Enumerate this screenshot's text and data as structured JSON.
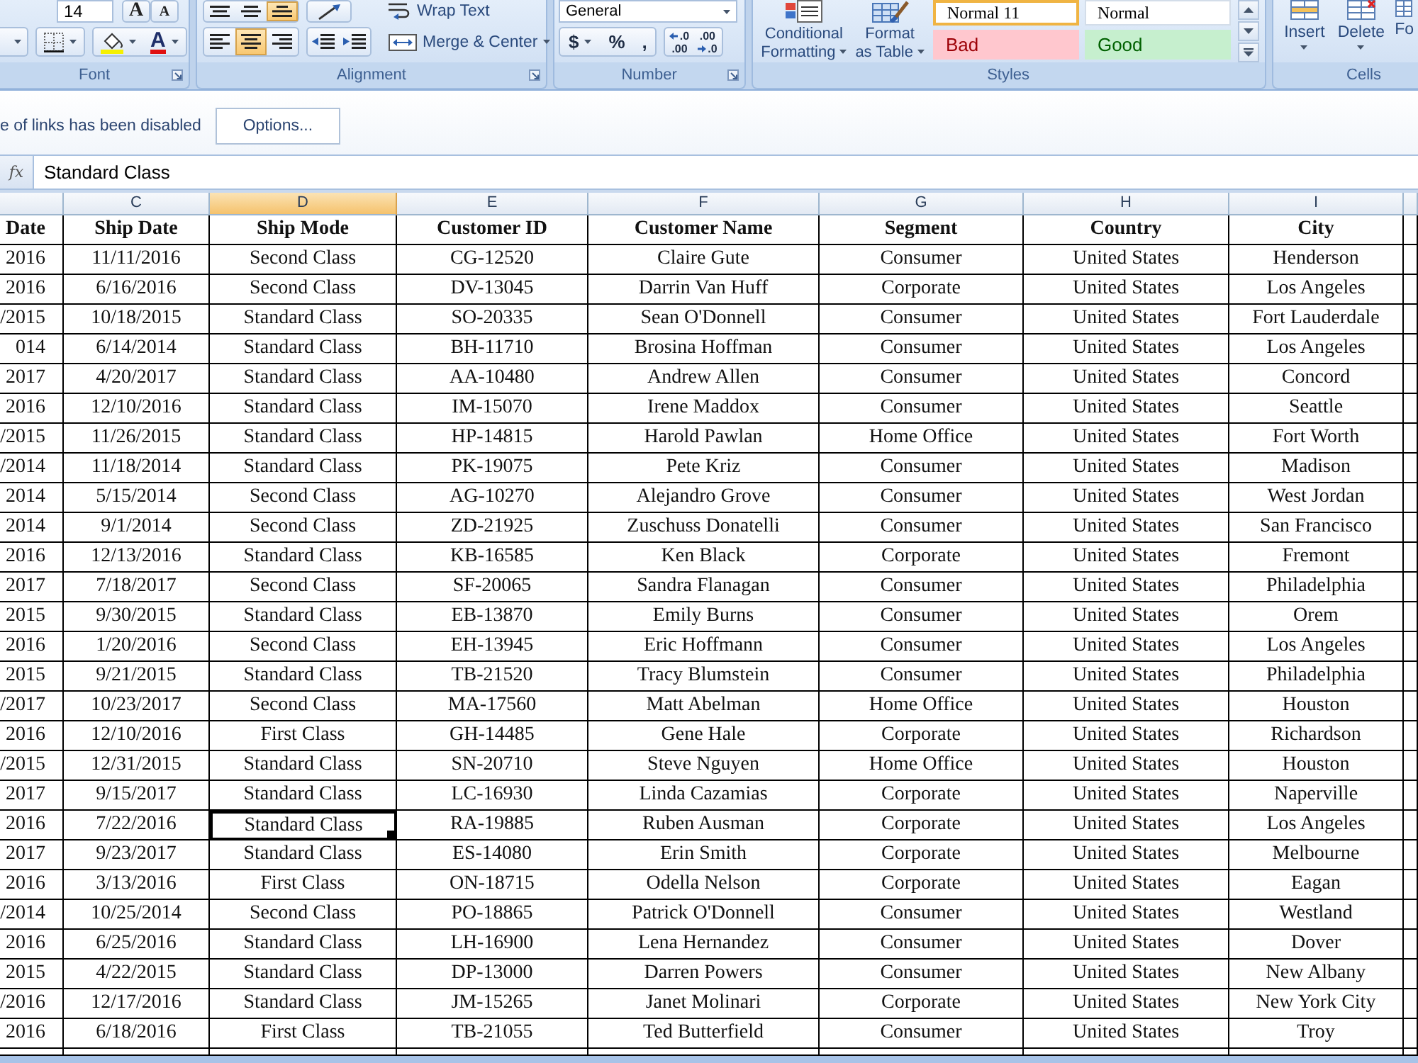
{
  "ribbon": {
    "font_group": {
      "label": "Font",
      "size": "14",
      "grow": "A",
      "shrink": "A",
      "font_color": "A"
    },
    "alignment_group": {
      "label": "Alignment",
      "vertical": [
        {
          "kind": "top",
          "selected": false
        },
        {
          "kind": "middle",
          "selected": false
        },
        {
          "kind": "bottom",
          "selected": true
        }
      ],
      "horizontal": [
        {
          "kind": "left",
          "selected": false
        },
        {
          "kind": "center",
          "selected": true
        },
        {
          "kind": "right",
          "selected": false
        }
      ],
      "wrap": "Wrap Text",
      "merge": "Merge & Center"
    },
    "number_group": {
      "label": "Number",
      "format": "General",
      "currency": "$",
      "percent": "%",
      "comma": ",",
      "decimals": [
        {
          "kind": "increase",
          "top": ".0",
          "bottom": ".00"
        },
        {
          "kind": "decrease",
          "top": ".00",
          "bottom": ".0"
        }
      ]
    },
    "styles_group": {
      "label": "Styles",
      "commands": [
        {
          "kind": "conditional",
          "lines": [
            "Conditional",
            "Formatting"
          ]
        },
        {
          "kind": "table",
          "lines": [
            "Format",
            "as Table"
          ]
        }
      ],
      "gallery": [
        {
          "label": "Normal 11",
          "kind": "normal",
          "selected": true
        },
        {
          "label": "Normal",
          "kind": "normal",
          "selected": false
        },
        {
          "label": "Bad",
          "kind": "bad",
          "selected": false
        },
        {
          "label": "Good",
          "kind": "good",
          "selected": false
        }
      ]
    },
    "cells_group": {
      "label": "Cells",
      "commands": [
        {
          "kind": "insert",
          "label": "Insert",
          "menu": true
        },
        {
          "kind": "delete",
          "label": "Delete",
          "menu": true
        },
        {
          "kind": "format",
          "label": "Fo",
          "menu": false
        }
      ]
    }
  },
  "message_bar": {
    "text": "e of links has been disabled",
    "button": "Options..."
  },
  "formula_bar": {
    "function_label": "fx",
    "value": "Standard Class"
  },
  "table": {
    "columns": [
      {
        "header": "Date",
        "selected": false
      },
      {
        "letter": "C",
        "header": "Ship Date",
        "selected": false
      },
      {
        "letter": "D",
        "header": "Ship Mode",
        "selected": true
      },
      {
        "letter": "E",
        "header": "Customer ID",
        "selected": false
      },
      {
        "letter": "F",
        "header": "Customer Name",
        "selected": false
      },
      {
        "letter": "G",
        "header": "Segment",
        "selected": false
      },
      {
        "letter": "H",
        "header": "Country",
        "selected": false
      },
      {
        "letter": "I",
        "header": "City",
        "selected": false
      }
    ],
    "rows": [
      {
        "cells": [
          "2016",
          "11/11/2016",
          "Second Class",
          "CG-12520",
          "Claire Gute",
          "Consumer",
          "United States",
          "Henderson"
        ],
        "selected": false
      },
      {
        "cells": [
          "2016",
          "6/16/2016",
          "Second Class",
          "DV-13045",
          "Darrin Van Huff",
          "Corporate",
          "United States",
          "Los Angeles"
        ],
        "selected": false
      },
      {
        "cells": [
          "/2015",
          "10/18/2015",
          "Standard Class",
          "SO-20335",
          "Sean O'Donnell",
          "Consumer",
          "United States",
          "Fort Lauderdale"
        ],
        "selected": false
      },
      {
        "cells": [
          "014",
          "6/14/2014",
          "Standard Class",
          "BH-11710",
          "Brosina Hoffman",
          "Consumer",
          "United States",
          "Los Angeles"
        ],
        "selected": false
      },
      {
        "cells": [
          "2017",
          "4/20/2017",
          "Standard Class",
          "AA-10480",
          "Andrew Allen",
          "Consumer",
          "United States",
          "Concord"
        ],
        "selected": false
      },
      {
        "cells": [
          "2016",
          "12/10/2016",
          "Standard Class",
          "IM-15070",
          "Irene Maddox",
          "Consumer",
          "United States",
          "Seattle"
        ],
        "selected": false
      },
      {
        "cells": [
          "/2015",
          "11/26/2015",
          "Standard Class",
          "HP-14815",
          "Harold Pawlan",
          "Home Office",
          "United States",
          "Fort Worth"
        ],
        "selected": false
      },
      {
        "cells": [
          "/2014",
          "11/18/2014",
          "Standard Class",
          "PK-19075",
          "Pete Kriz",
          "Consumer",
          "United States",
          "Madison"
        ],
        "selected": false
      },
      {
        "cells": [
          "2014",
          "5/15/2014",
          "Second Class",
          "AG-10270",
          "Alejandro Grove",
          "Consumer",
          "United States",
          "West Jordan"
        ],
        "selected": false
      },
      {
        "cells": [
          "2014",
          "9/1/2014",
          "Second Class",
          "ZD-21925",
          "Zuschuss Donatelli",
          "Consumer",
          "United States",
          "San Francisco"
        ],
        "selected": false
      },
      {
        "cells": [
          "2016",
          "12/13/2016",
          "Standard Class",
          "KB-16585",
          "Ken Black",
          "Corporate",
          "United States",
          "Fremont"
        ],
        "selected": false
      },
      {
        "cells": [
          "2017",
          "7/18/2017",
          "Second Class",
          "SF-20065",
          "Sandra Flanagan",
          "Consumer",
          "United States",
          "Philadelphia"
        ],
        "selected": false
      },
      {
        "cells": [
          "2015",
          "9/30/2015",
          "Standard Class",
          "EB-13870",
          "Emily Burns",
          "Consumer",
          "United States",
          "Orem"
        ],
        "selected": false
      },
      {
        "cells": [
          "2016",
          "1/20/2016",
          "Second Class",
          "EH-13945",
          "Eric Hoffmann",
          "Consumer",
          "United States",
          "Los Angeles"
        ],
        "selected": false
      },
      {
        "cells": [
          "2015",
          "9/21/2015",
          "Standard Class",
          "TB-21520",
          "Tracy Blumstein",
          "Consumer",
          "United States",
          "Philadelphia"
        ],
        "selected": false
      },
      {
        "cells": [
          "/2017",
          "10/23/2017",
          "Second Class",
          "MA-17560",
          "Matt Abelman",
          "Home Office",
          "United States",
          "Houston"
        ],
        "selected": false
      },
      {
        "cells": [
          "2016",
          "12/10/2016",
          "First Class",
          "GH-14485",
          "Gene Hale",
          "Corporate",
          "United States",
          "Richardson"
        ],
        "selected": false
      },
      {
        "cells": [
          "/2015",
          "12/31/2015",
          "Standard Class",
          "SN-20710",
          "Steve Nguyen",
          "Home Office",
          "United States",
          "Houston"
        ],
        "selected": false
      },
      {
        "cells": [
          "2017",
          "9/15/2017",
          "Standard Class",
          "LC-16930",
          "Linda Cazamias",
          "Corporate",
          "United States",
          "Naperville"
        ],
        "selected": false
      },
      {
        "cells": [
          "2016",
          "7/22/2016",
          "Standard Class",
          "RA-19885",
          "Ruben Ausman",
          "Corporate",
          "United States",
          "Los Angeles"
        ],
        "selected": true
      },
      {
        "cells": [
          "2017",
          "9/23/2017",
          "Standard Class",
          "ES-14080",
          "Erin Smith",
          "Corporate",
          "United States",
          "Melbourne"
        ],
        "selected": false
      },
      {
        "cells": [
          "2016",
          "3/13/2016",
          "First Class",
          "ON-18715",
          "Odella Nelson",
          "Corporate",
          "United States",
          "Eagan"
        ],
        "selected": false
      },
      {
        "cells": [
          "/2014",
          "10/25/2014",
          "Second Class",
          "PO-18865",
          "Patrick O'Donnell",
          "Consumer",
          "United States",
          "Westland"
        ],
        "selected": false
      },
      {
        "cells": [
          "2016",
          "6/25/2016",
          "Standard Class",
          "LH-16900",
          "Lena Hernandez",
          "Consumer",
          "United States",
          "Dover"
        ],
        "selected": false
      },
      {
        "cells": [
          "2015",
          "4/22/2015",
          "Standard Class",
          "DP-13000",
          "Darren Powers",
          "Consumer",
          "United States",
          "New Albany"
        ],
        "selected": false
      },
      {
        "cells": [
          "/2016",
          "12/17/2016",
          "Standard Class",
          "JM-15265",
          "Janet Molinari",
          "Corporate",
          "United States",
          "New York City"
        ],
        "selected": false
      },
      {
        "cells": [
          "2016",
          "6/18/2016",
          "First Class",
          "TB-21055",
          "Ted Butterfield",
          "Consumer",
          "United States",
          "Troy"
        ],
        "selected": false
      }
    ]
  }
}
